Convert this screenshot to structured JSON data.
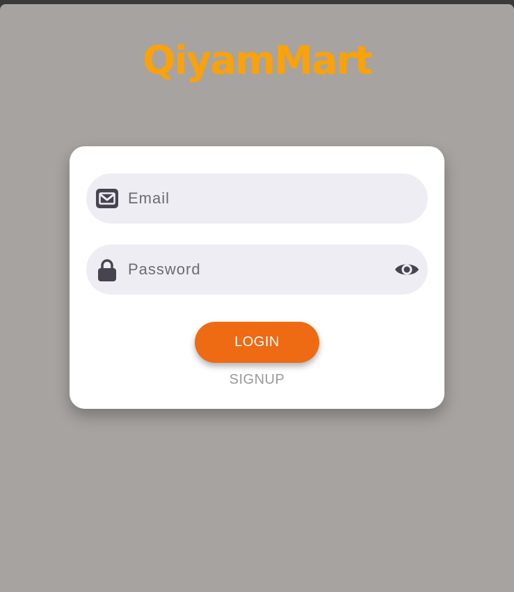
{
  "app": {
    "logo_text": "QiyamMart",
    "brand_color": "#f9a20b",
    "background_color": "#a7a3a0"
  },
  "login_form": {
    "email": {
      "icon": "envelope-icon",
      "placeholder": "Email",
      "value": ""
    },
    "password": {
      "icon": "lock-icon",
      "placeholder": "Password",
      "value": "",
      "toggle_icon": "eye-icon"
    },
    "login_label": "LOGIN",
    "login_color": "#ee6a13",
    "signup_label": "SIGNUP"
  }
}
